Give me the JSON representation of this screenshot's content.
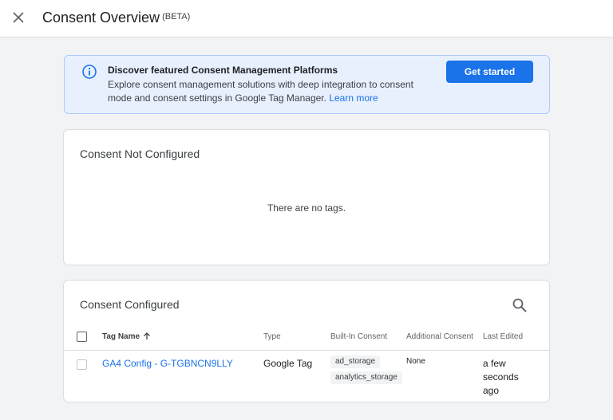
{
  "header": {
    "title": "Consent Overview",
    "badge": "(BETA)",
    "close_icon": "close-icon"
  },
  "banner": {
    "icon": "info-icon",
    "title": "Discover featured Consent Management Platforms",
    "body": "Explore consent management solutions with deep integration to consent mode and consent settings in Google Tag Manager.",
    "link": "Learn more",
    "button": "Get started"
  },
  "not_configured": {
    "title": "Consent Not Configured",
    "empty_message": "There are no tags."
  },
  "configured": {
    "title": "Consent Configured",
    "search_icon": "search-icon",
    "columns": {
      "tag_name": "Tag Name",
      "type": "Type",
      "built_in": "Built-In Consent",
      "additional": "Additional Consent",
      "last_edited": "Last Edited"
    },
    "sort_icon": "arrow-up-icon",
    "rows": [
      {
        "tag_name": "GA4 Config - G-TGBNCN9LLY",
        "type": "Google Tag",
        "built_in": [
          "ad_storage",
          "analytics_storage"
        ],
        "additional": "None",
        "last_edited": "a few seconds ago"
      }
    ]
  },
  "colors": {
    "accent": "#1a73e8",
    "banner_bg": "#e8f0fe",
    "page_bg": "#f1f3f4"
  }
}
